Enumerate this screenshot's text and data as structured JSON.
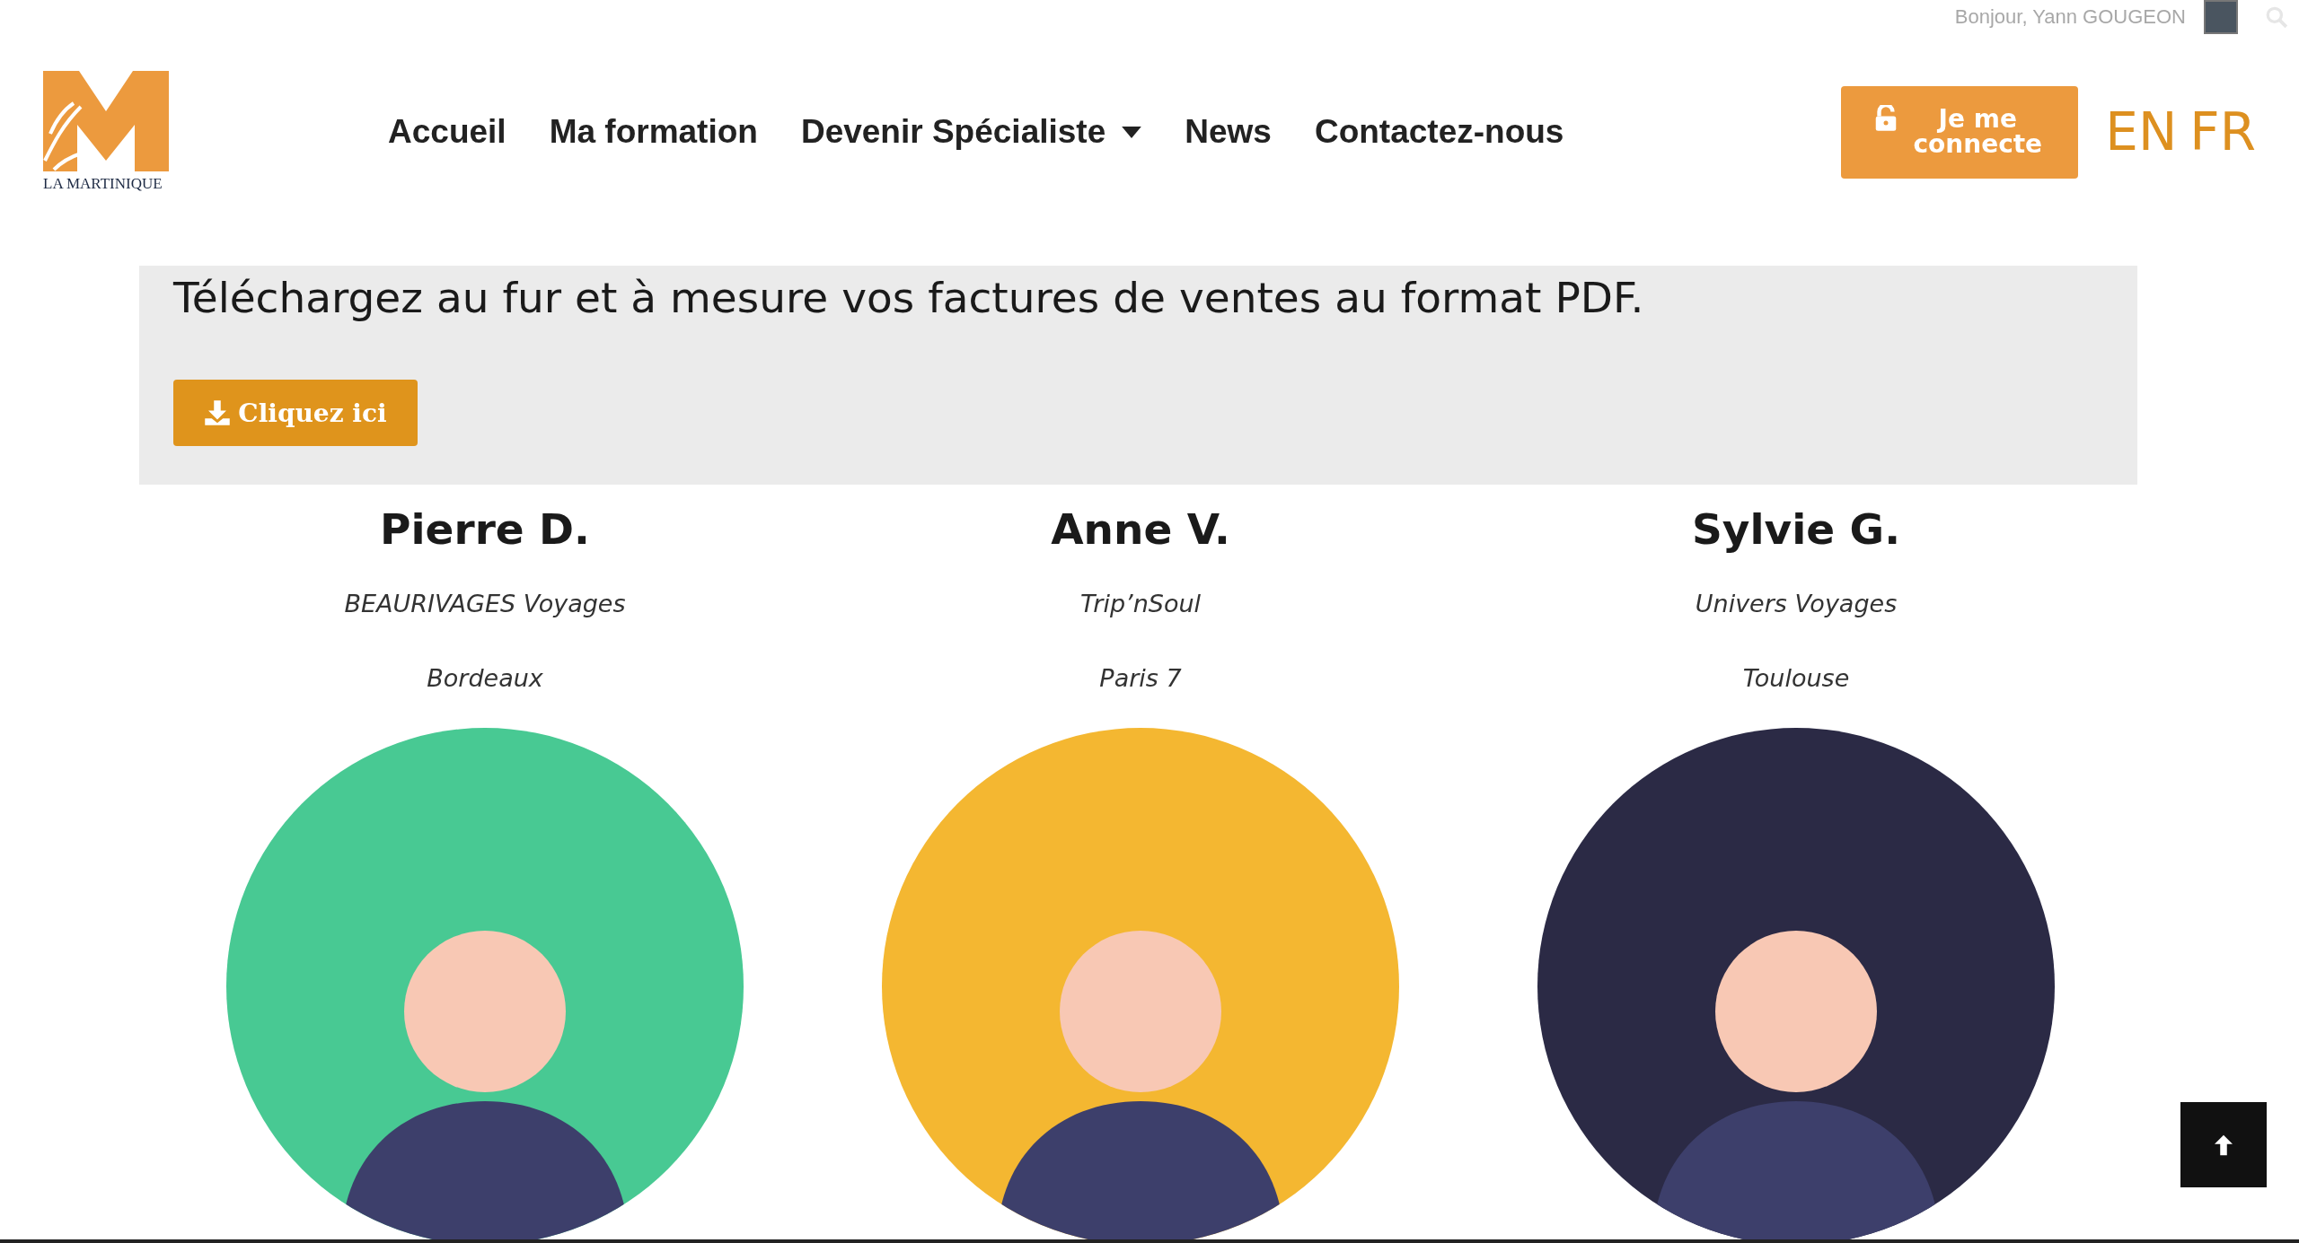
{
  "top_bar": {
    "greeting": "Bonjour, Yann GOUGEON"
  },
  "header": {
    "logo_text": "LA MARTINIQUE",
    "nav": [
      {
        "label": "Accueil",
        "has_dropdown": false
      },
      {
        "label": "Ma formation",
        "has_dropdown": false
      },
      {
        "label": "Devenir Spécialiste",
        "has_dropdown": true
      },
      {
        "label": "News",
        "has_dropdown": false
      },
      {
        "label": "Contactez-nous",
        "has_dropdown": false
      }
    ],
    "login_button": "Je me connecte",
    "languages": [
      "EN",
      "FR"
    ]
  },
  "banner": {
    "text": "Téléchargez au fur et à mesure vos factures de ventes au format PDF.",
    "button": "Cliquez ici"
  },
  "profiles": [
    {
      "name": "Pierre D.",
      "company": "BEAURIVAGES Voyages",
      "city": "Bordeaux",
      "color": "#48c993"
    },
    {
      "name": "Anne V.",
      "company": "Trip’nSoul",
      "city": "Paris 7",
      "color": "#f4b731"
    },
    {
      "name": "Sylvie G.",
      "company": "Univers Voyages",
      "city": "Toulouse",
      "color": "#2b2a45"
    }
  ]
}
